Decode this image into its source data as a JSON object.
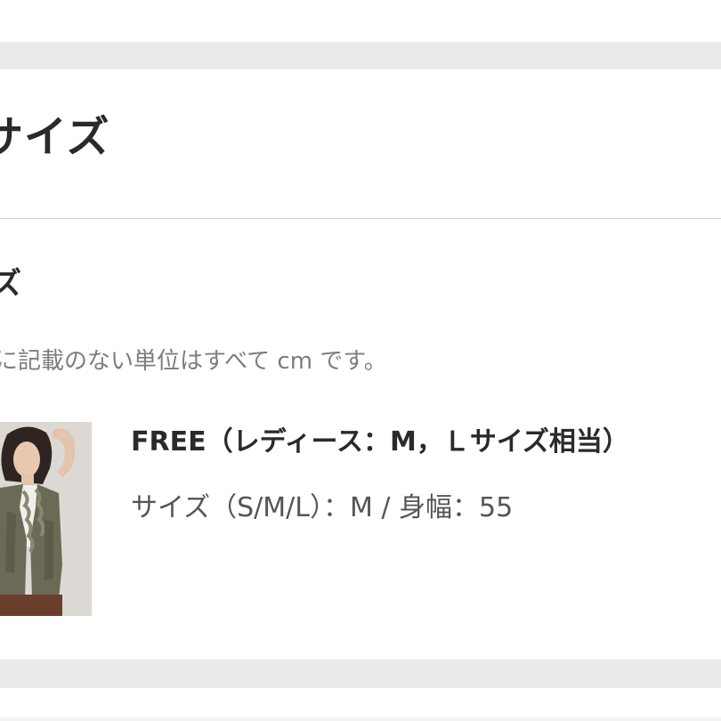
{
  "section": {
    "title": "サイズ"
  },
  "sizes": {
    "title": "ズ",
    "note": "に記載のない単位はすべて cm です。"
  },
  "product": {
    "image_icon": "model-photo",
    "size_heading": "FREE（レディース：M，Ｌサイズ相当）",
    "size_detail": "サイズ（S/M/L）：M / 身幅：55"
  },
  "colors": {
    "band": "#ebebeb",
    "divider": "#cfcfcf",
    "note_text": "#7d7d7d"
  }
}
